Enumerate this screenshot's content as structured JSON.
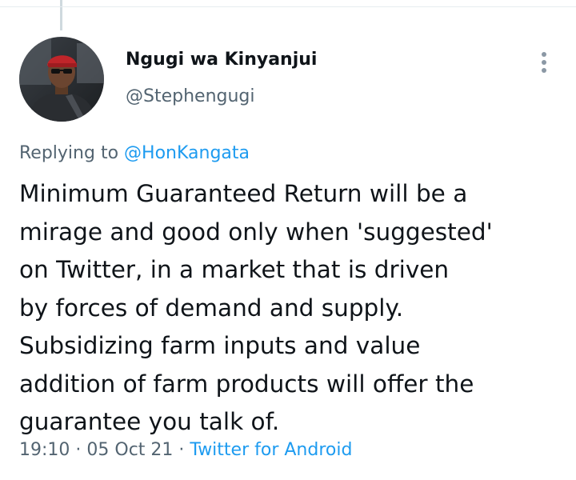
{
  "tweet": {
    "author": {
      "display_name": "Ngugi wa Kinyanjui",
      "handle": "@Stephengugi",
      "avatar_icon": "user-photo"
    },
    "more_icon": "more-vertical-icon",
    "reply_context": {
      "prefix": "Replying to ",
      "mention": "@HonKangata"
    },
    "text_lines": [
      "Minimum Guaranteed Return will be a",
      "mirage and good only when 'suggested'",
      "on Twitter, in a market that is driven",
      "by forces of demand and supply.",
      "Subsidizing farm inputs and value",
      "addition of farm products will offer the",
      "guarantee you talk of."
    ],
    "meta": {
      "time": "19:10",
      "separator": " · ",
      "date": "05 Oct 21",
      "source": "Twitter for Android"
    }
  },
  "colors": {
    "text_primary": "#0f1419",
    "text_secondary": "#536471",
    "link": "#1d9bf0",
    "thread_line": "#cfd9de"
  }
}
